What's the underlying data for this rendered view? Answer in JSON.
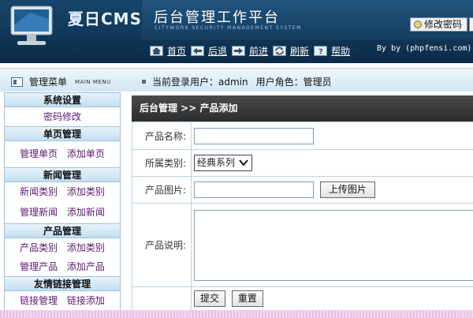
{
  "header": {
    "brand": "夏日CMS",
    "subtitle": "后台管理工作平台",
    "subtitle_en": "CITYWORK SECURITY MANAGEMENT SYSTEM",
    "change_password": "修改密码",
    "nav": [
      {
        "label": "首页",
        "icon": "home-icon"
      },
      {
        "label": "后退",
        "icon": "back-arrow-icon"
      },
      {
        "label": "前进",
        "icon": "forward-arrow-icon"
      },
      {
        "label": "刷新",
        "icon": "refresh-icon"
      },
      {
        "label": "帮助",
        "icon": "help-icon"
      }
    ],
    "byline": "By by (phpfensi.com)"
  },
  "bar": {
    "menu_title": "管理菜单",
    "menu_title_en": "MAIN MENU",
    "user_label": "当前登录用户：",
    "user_name": "admin",
    "role_label": "用户角色：",
    "role_name": "管理员"
  },
  "sidebar": [
    {
      "title": "系统设置",
      "links": [
        [
          "密码修改"
        ]
      ]
    },
    {
      "title": "单页管理",
      "links": [
        [
          "管理单页",
          "添加单页"
        ]
      ]
    },
    {
      "title": "新闻管理",
      "links": [
        [
          "新闻类别",
          "添加类别"
        ],
        [
          "管理新闻",
          "添加新闻"
        ]
      ]
    },
    {
      "title": "产品管理",
      "links": [
        [
          "产品类别",
          "添加类别"
        ],
        [
          "管理产品",
          "添加产品"
        ]
      ]
    },
    {
      "title": "友情链接管理",
      "links": [
        [
          "链接管理",
          "链接添加"
        ]
      ]
    }
  ],
  "main": {
    "breadcrumb": "后台管理 >> 产品添加",
    "form": {
      "name_label": "产品名称:",
      "category_label": "所属类别:",
      "category_value": "经典系列",
      "image_label": "产品图片:",
      "upload_button": "上传图片",
      "desc_label": "产品说明:",
      "submit": "提交",
      "reset": "重置"
    }
  },
  "colors": {
    "header": "#17456a",
    "sidebar_header": "#c4def0",
    "breadcrumb": "#2c2c2c",
    "link": "#5a1a6e"
  }
}
